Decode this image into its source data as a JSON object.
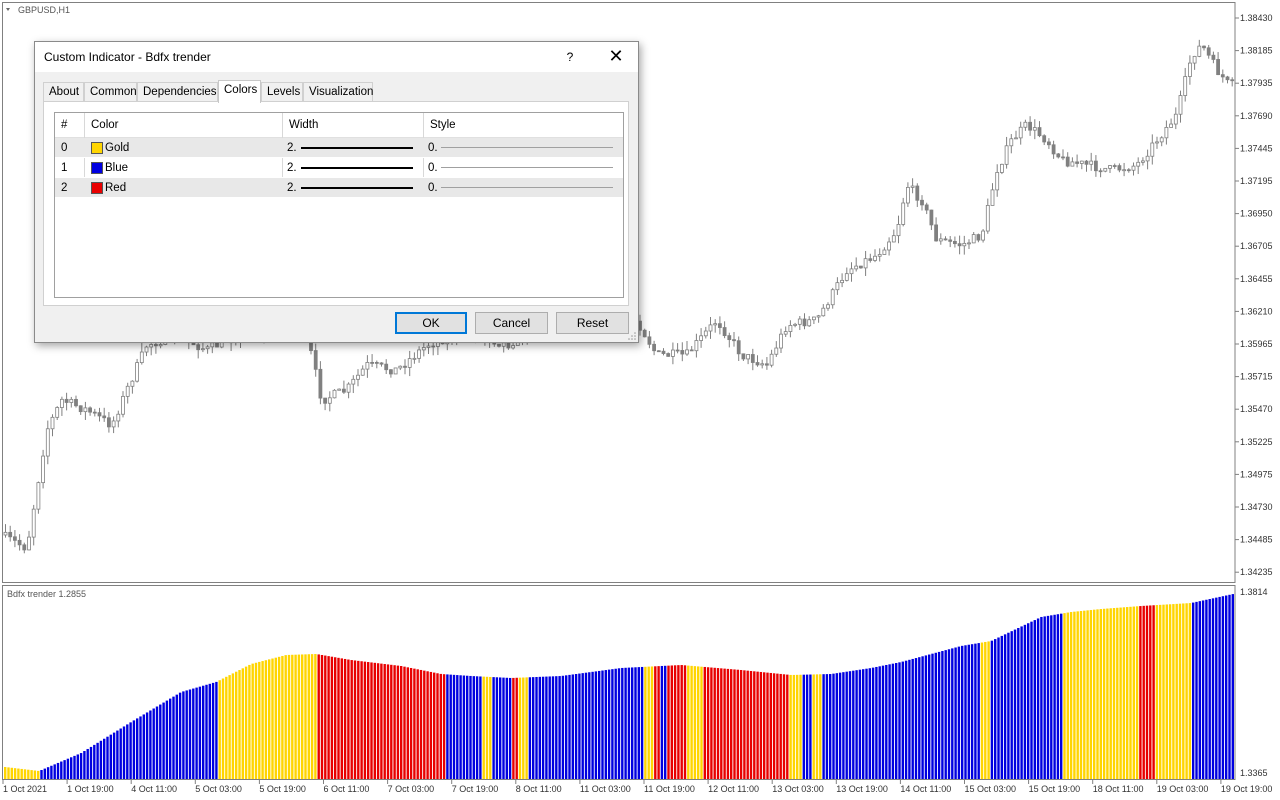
{
  "main_chart": {
    "symbol": "GBPUSD,H1",
    "price_ticks": [
      "1.38430",
      "1.38185",
      "1.37935",
      "1.37690",
      "1.37445",
      "1.37195",
      "1.36950",
      "1.36705",
      "1.36455",
      "1.36210",
      "1.35965",
      "1.35715",
      "1.35470",
      "1.35225",
      "1.34975",
      "1.34730",
      "1.34485",
      "1.34235"
    ]
  },
  "indicator_pane": {
    "label": "Bdfx trender 1.2855",
    "ticks": [
      "1.3814",
      "1.3365"
    ]
  },
  "time_axis": {
    "labels": [
      "1 Oct 2021",
      "1 Oct 19:00",
      "4 Oct 11:00",
      "5 Oct 03:00",
      "5 Oct 19:00",
      "6 Oct 11:00",
      "7 Oct 03:00",
      "7 Oct 19:00",
      "8 Oct 11:00",
      "11 Oct 03:00",
      "11 Oct 19:00",
      "12 Oct 11:00",
      "13 Oct 03:00",
      "13 Oct 19:00",
      "14 Oct 11:00",
      "15 Oct 03:00",
      "15 Oct 19:00",
      "18 Oct 11:00",
      "19 Oct 03:00",
      "19 Oct 19:00"
    ]
  },
  "colors": {
    "gold": "#ffd500",
    "blue": "#0000e0",
    "red": "#e80000",
    "candle": "#808080"
  },
  "dialog": {
    "title": "Custom Indicator - Bdfx trender",
    "help": "?",
    "close": "✕",
    "tabs": [
      {
        "label": "About",
        "active": false
      },
      {
        "label": "Common",
        "active": false
      },
      {
        "label": "Dependencies",
        "active": false
      },
      {
        "label": "Colors",
        "active": true
      },
      {
        "label": "Levels",
        "active": false
      },
      {
        "label": "Visualization",
        "active": false
      }
    ],
    "grid": {
      "headers": {
        "index": "#",
        "color": "Color",
        "width": "Width",
        "style": "Style"
      },
      "rows": [
        {
          "index": "0",
          "color_name": "Gold",
          "swatch": "#ffd500",
          "width": "2.",
          "style": "0."
        },
        {
          "index": "1",
          "color_name": "Blue",
          "swatch": "#0000e0",
          "width": "2.",
          "style": "0."
        },
        {
          "index": "2",
          "color_name": "Red",
          "swatch": "#e80000",
          "width": "2.",
          "style": "0."
        }
      ]
    },
    "buttons": {
      "ok": "OK",
      "cancel": "Cancel",
      "reset": "Reset"
    }
  }
}
